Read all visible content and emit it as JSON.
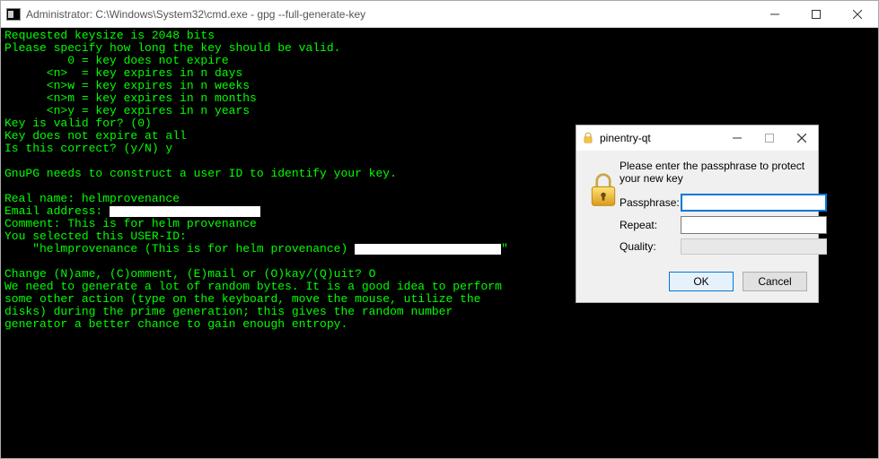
{
  "terminal": {
    "title": "Administrator: C:\\Windows\\System32\\cmd.exe - gpg  --full-generate-key",
    "lines": {
      "l0": "Requested keysize is 2048 bits",
      "l1": "Please specify how long the key should be valid.",
      "l2": "         0 = key does not expire",
      "l3": "      <n>  = key expires in n days",
      "l4": "      <n>w = key expires in n weeks",
      "l5": "      <n>m = key expires in n months",
      "l6": "      <n>y = key expires in n years",
      "l7": "Key is valid for? (0)",
      "l8": "Key does not expire at all",
      "l9": "Is this correct? (y/N) y",
      "l10": "",
      "l11": "GnuPG needs to construct a user ID to identify your key.",
      "l12": "",
      "l13": "Real name: helmprovenance",
      "l14a": "Email address: ",
      "l15": "Comment: This is for helm provenance",
      "l16": "You selected this USER-ID:",
      "l17a": "    \"helmprovenance (This is for helm provenance) ",
      "l17b": "\"",
      "l18": "",
      "l19": "Change (N)ame, (C)omment, (E)mail or (O)kay/(Q)uit? O",
      "l20": "We need to generate a lot of random bytes. It is a good idea to perform",
      "l21": "some other action (type on the keyboard, move the mouse, utilize the",
      "l22": "disks) during the prime generation; this gives the random number",
      "l23": "generator a better chance to gain enough entropy."
    }
  },
  "dialog": {
    "title": "pinentry-qt",
    "instruction": "Please enter the passphrase to protect your new key",
    "labels": {
      "passphrase": "Passphrase:",
      "repeat": "Repeat:",
      "quality": "Quality:"
    },
    "values": {
      "passphrase": "",
      "repeat": ""
    },
    "buttons": {
      "ok": "OK",
      "cancel": "Cancel"
    }
  }
}
